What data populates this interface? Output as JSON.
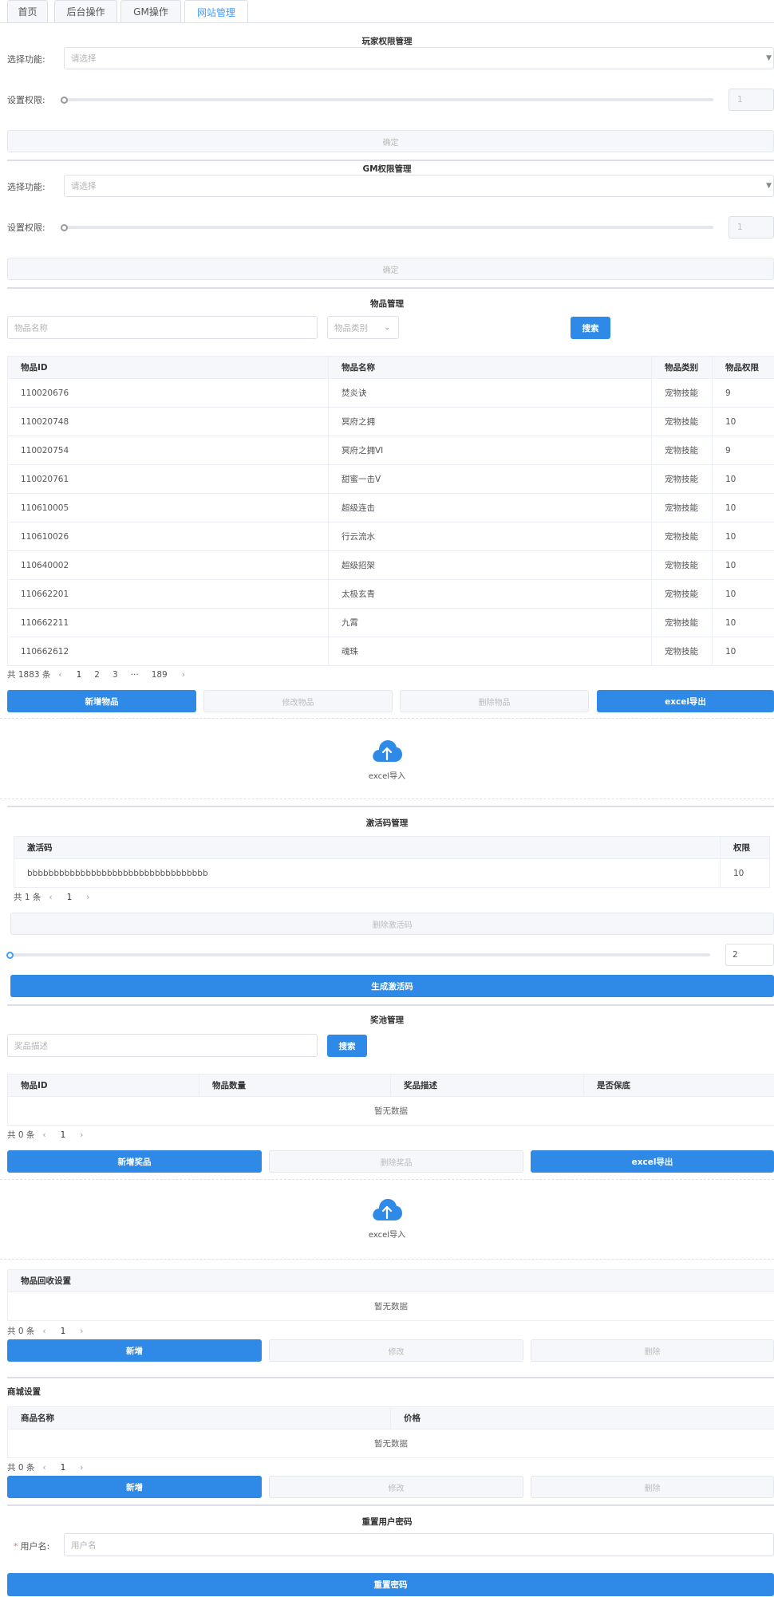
{
  "tabs": [
    "首页",
    "后台操作",
    "GM操作",
    "网站管理"
  ],
  "player_perm": {
    "title": "玩家权限管理",
    "select_label": "选择功能:",
    "select_placeholder": "请选择",
    "perm_label": "设置权限:",
    "perm_value": "1",
    "confirm": "确定"
  },
  "gm_perm": {
    "title": "GM权限管理",
    "select_label": "选择功能:",
    "select_placeholder": "请选择",
    "perm_label": "设置权限:",
    "perm_value": "1",
    "confirm": "确定"
  },
  "items": {
    "title": "物品管理",
    "name_placeholder": "物品名称",
    "category_placeholder": "物品类别",
    "search": "搜索",
    "columns": [
      "物品ID",
      "物品名称",
      "物品类别",
      "物品权限"
    ],
    "rows": [
      [
        "110020676",
        "焚炎诀",
        "宠物技能",
        "9"
      ],
      [
        "110020748",
        "冥府之拥",
        "宠物技能",
        "10"
      ],
      [
        "110020754",
        "冥府之拥VI",
        "宠物技能",
        "9"
      ],
      [
        "110020761",
        "甜蜜一击V",
        "宠物技能",
        "10"
      ],
      [
        "110610005",
        "超级连击",
        "宠物技能",
        "10"
      ],
      [
        "110610026",
        "行云流水",
        "宠物技能",
        "10"
      ],
      [
        "110640002",
        "超级招架",
        "宠物技能",
        "10"
      ],
      [
        "110662201",
        "太极玄青",
        "宠物技能",
        "10"
      ],
      [
        "110662211",
        "九霄",
        "宠物技能",
        "10"
      ],
      [
        "110662612",
        "魂珠",
        "宠物技能",
        "10"
      ]
    ],
    "total": "共 1883 条",
    "pages": [
      "1",
      "2",
      "3",
      "···",
      "189"
    ],
    "btn_add": "新增物品",
    "btn_edit": "修改物品",
    "btn_delete": "删除物品",
    "btn_export": "excel导出",
    "import_label": "excel导入"
  },
  "codes": {
    "title": "激活码管理",
    "columns": [
      "激活码",
      "权限"
    ],
    "rows": [
      [
        "bbbbbbbbbbbbbbbbbbbbbbbbbbbbbbbbbb",
        "10"
      ]
    ],
    "total": "共 1 条",
    "pages": [
      "1"
    ],
    "btn_delete": "删除激活码",
    "count_value": "2",
    "btn_generate": "生成激活码"
  },
  "prize": {
    "title": "奖池管理",
    "desc_placeholder": "奖品描述",
    "search": "搜索",
    "columns": [
      "物品ID",
      "物品数量",
      "奖品描述",
      "是否保底"
    ],
    "empty": "暂无数据",
    "total": "共 0 条",
    "pages": [
      "1"
    ],
    "btn_add": "新增奖品",
    "btn_delete": "删除奖品",
    "btn_export": "excel导出",
    "import_label": "excel导入"
  },
  "recycle": {
    "columns": [
      "物品回收设置"
    ],
    "empty": "暂无数据",
    "total": "共 0 条",
    "pages": [
      "1"
    ],
    "btn_add": "新增",
    "btn_edit": "修改",
    "btn_delete": "删除"
  },
  "shop": {
    "title": "商城设置",
    "columns": [
      "商品名称",
      "价格"
    ],
    "empty": "暂无数据",
    "total": "共 0 条",
    "pages": [
      "1"
    ],
    "btn_add": "新增",
    "btn_edit": "修改",
    "btn_delete": "删除"
  },
  "reset_pwd": {
    "title": "重置用户密码",
    "required_mark": "*",
    "user_label": "用户名:",
    "user_placeholder": "用户名",
    "btn_reset": "重置密码"
  },
  "colors": {
    "primary": "#2e8ae6",
    "accent": "#409eff",
    "disabled_bg": "#f5f7fa",
    "border": "#dcdfe6",
    "required": "#f56c6c"
  }
}
